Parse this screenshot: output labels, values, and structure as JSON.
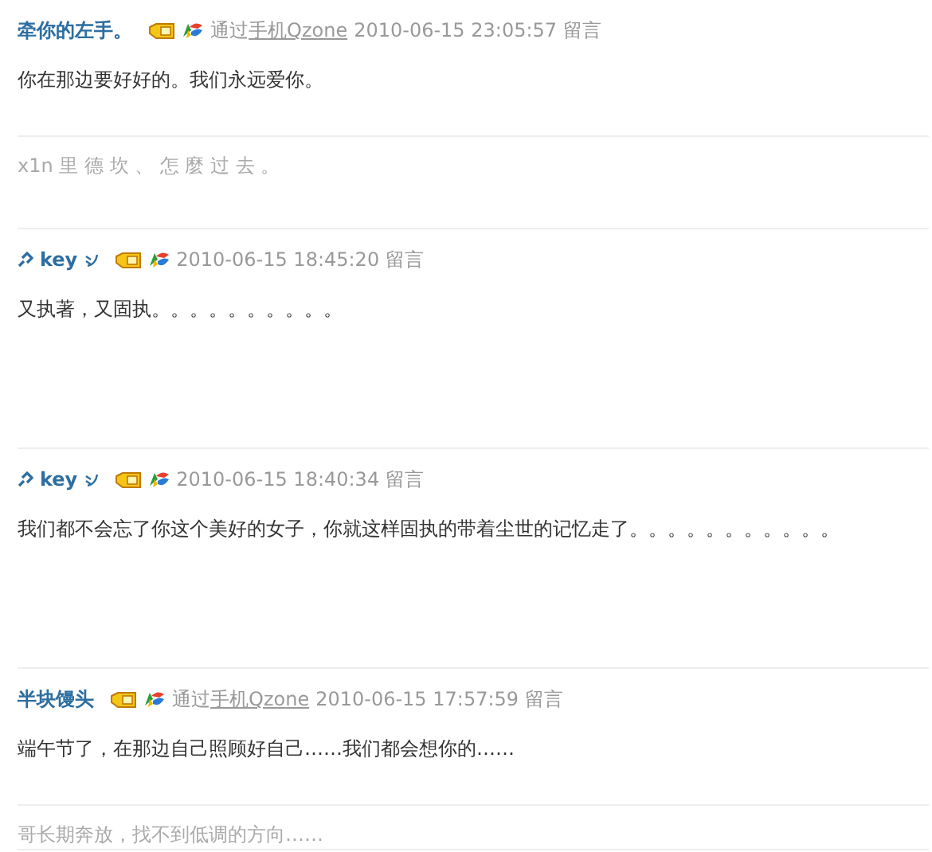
{
  "entries": [
    {
      "author": "牵你的左手。",
      "decorated": false,
      "via_prefix": "通过",
      "via_link": "手机Qzone",
      "time": "2010-06-15 23:05:57",
      "action": "留言",
      "message": "你在那边要好好的。我们永远爱你。",
      "signature": "x1n 里 德 坎 、 怎 麼 过 去 。"
    },
    {
      "author": "key",
      "decorated": true,
      "time": "2010-06-15 18:45:20",
      "action": "留言",
      "message": "又执著，又固执。。。。。。。。。。"
    },
    {
      "author": "key",
      "decorated": true,
      "time": "2010-06-15 18:40:34",
      "action": "留言",
      "message": "我们都不会忘了你这个美好的女子，你就这样固执的带着尘世的记忆走了。。。。。。。。。。。"
    },
    {
      "author": "半块馒头",
      "decorated": false,
      "via_prefix": "通过",
      "via_link": "手机Qzone",
      "time": "2010-06-15 17:57:59",
      "action": "留言",
      "message": "端午节了，在那边自己照顾好自己……我们都会想你的……",
      "signature": "哥长期奔放，找不到低调的方向……"
    }
  ]
}
